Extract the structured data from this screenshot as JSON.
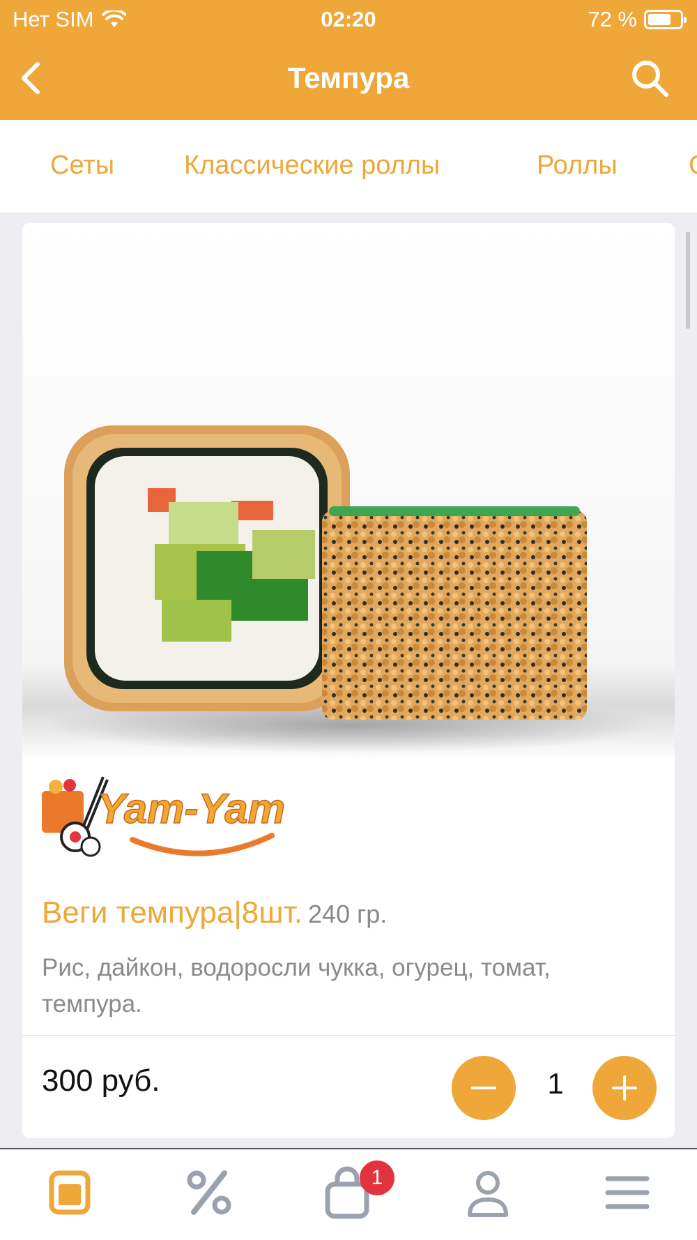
{
  "status_bar": {
    "carrier": "Нет SIM",
    "time": "02:20",
    "battery": "72 %",
    "battery_level": 0.72
  },
  "nav": {
    "title": "Темпура",
    "back_icon": "chevron-left-icon",
    "search_icon": "search-icon"
  },
  "categories": [
    "Сеты",
    "Классические роллы",
    "Роллы",
    "С"
  ],
  "product": {
    "name": "Веги темпура|8шт.",
    "weight": "240 гр.",
    "description": "Рис, дайкон, водоросли чукка, огурец, томат, темпура.",
    "price": "300 руб.",
    "quantity": "1",
    "brand": "Yam-Yam"
  },
  "tabbar": {
    "items": [
      "menu-icon",
      "discount-icon",
      "cart-icon",
      "profile-icon",
      "more-icon"
    ],
    "cart_badge": "1"
  },
  "colors": {
    "accent": "#eea738",
    "badge": "#e2343e",
    "inactive": "#9aa3ad"
  }
}
